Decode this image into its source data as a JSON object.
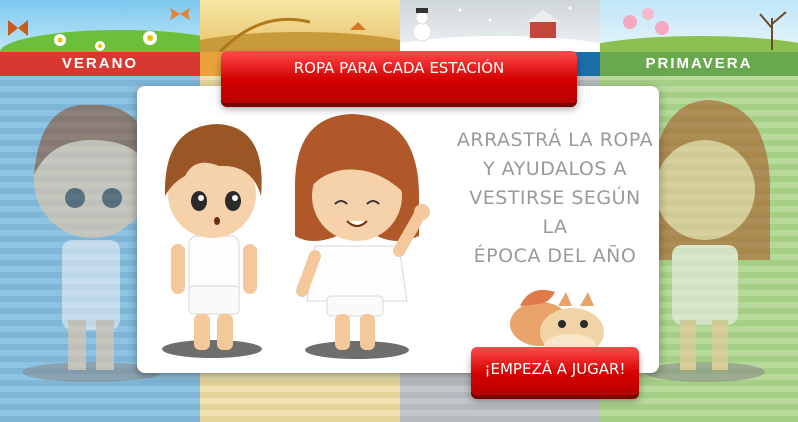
{
  "seasons": [
    {
      "label": "VERANO",
      "color": "#d8382f"
    },
    {
      "label": "",
      "color": "#e9c36a"
    },
    {
      "label": "",
      "color": "#9aa3a8"
    },
    {
      "label": "PRIMAVERA",
      "color": "#6aa84f"
    }
  ],
  "modal": {
    "title": "ROPA PARA CADA ESTACIÓN",
    "instructions": "ARRASTRÁ LA ROPA\nY AYUDALOS A\nVESTIRSE SEGÚN LA\nÉPOCA DEL AÑO",
    "start_button": "¡EMPEZÁ A JUGAR!"
  },
  "colors": {
    "button_red": "#d40000",
    "text_gray": "#9a9a9a",
    "stripe_blue": "#8fc3e3",
    "stripe_green": "#b7d99a"
  }
}
